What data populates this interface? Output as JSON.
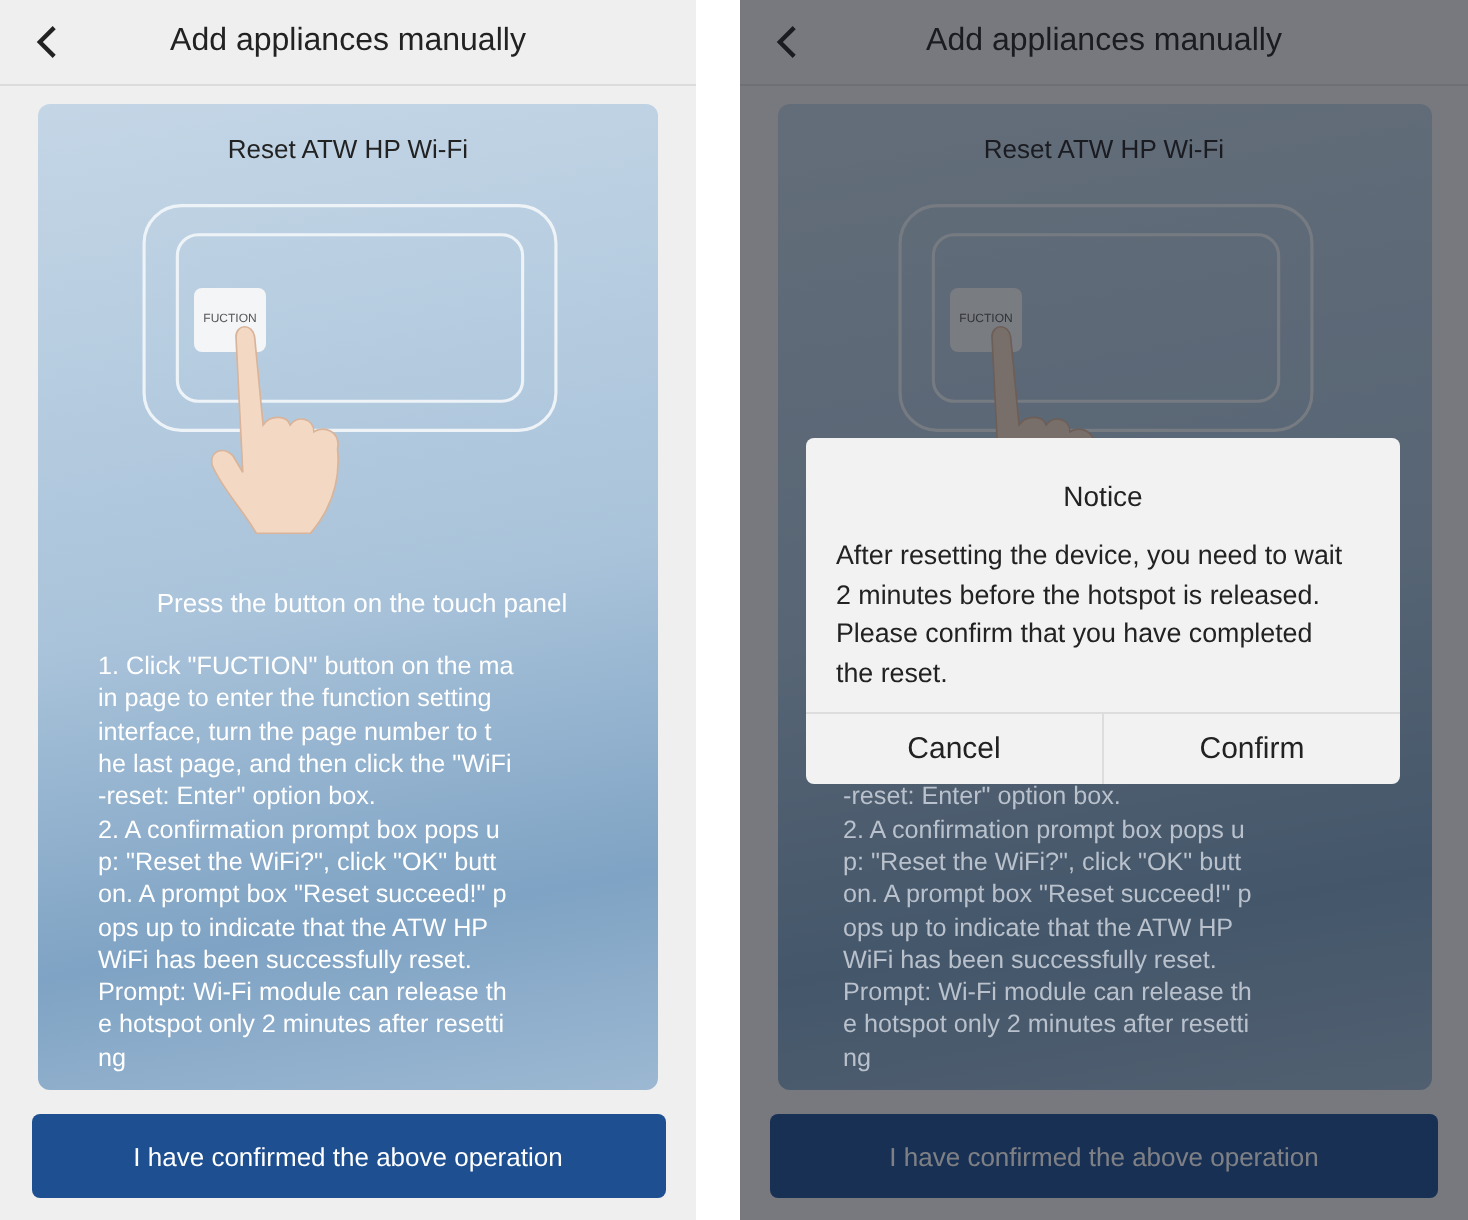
{
  "screens": [
    {
      "header": {
        "title": "Add appliances manually"
      },
      "card": {
        "title": "Reset ATW HP Wi-Fi",
        "panel_key": "FUCTION",
        "caption": "Press the button on the touch panel",
        "instructions": [
          "1. Click \"FUCTION\" button on the ma",
          "in page to enter the function setting",
          "interface, turn the page number to t",
          "he last page, and then click the \"WiFi",
          "-reset: Enter\" option box.",
          "2. A confirmation prompt box pops u",
          "p: \"Reset the WiFi?\", click \"OK\" butt",
          "on. A prompt box \"Reset succeed!\" p",
          "ops up to indicate that the ATW HP",
          "WiFi has been successfully reset.",
          "Prompt: Wi-Fi module can release th",
          "e hotspot only 2 minutes after resetti",
          "ng"
        ]
      },
      "button": "I have confirmed the above operation"
    },
    {
      "header": {
        "title": "Add appliances manually"
      },
      "card": {
        "title": "Reset ATW HP Wi-Fi",
        "panel_key": "FUCTION",
        "instructions": [
          "-reset: Enter\" option box.",
          "2. A confirmation prompt box pops u",
          "p: \"Reset the WiFi?\", click \"OK\" butt",
          "on. A prompt box \"Reset succeed!\" p",
          "ops up to indicate that the ATW HP",
          "WiFi has been successfully reset.",
          "Prompt: Wi-Fi module can release th",
          "e hotspot only 2 minutes after resetti",
          "ng"
        ]
      },
      "button": "I have confirmed the above operation",
      "dialog": {
        "title": "Notice",
        "message": "After resetting the device, you need to wait 2 minutes before the hotspot is released. Please confirm that you have completed the reset.",
        "buttons": [
          "Cancel",
          "Confirm"
        ]
      }
    }
  ]
}
